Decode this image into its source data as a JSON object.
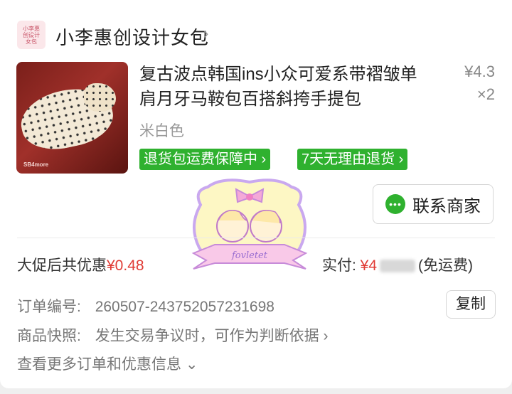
{
  "store": {
    "logo_lines": [
      "小李惠",
      "创设计",
      "女包"
    ],
    "name": "小李惠创设计女包",
    "chevron": "›"
  },
  "product": {
    "title": "复古波点韩国ins小众可爱系带褶皱单肩月牙马鞍包百搭斜挎手提包",
    "price": "¥4.3",
    "quantity": "×2",
    "sku": "米白色",
    "image_mark": "SB4more",
    "tags": [
      "退货包运费保障中 ›",
      "7天无理由退货 ›"
    ]
  },
  "contact_button": {
    "label": "联系商家",
    "icon": "chat-bubble-icon"
  },
  "summary": {
    "discount_prefix": "大促后共优惠",
    "discount_amount": "¥0.48",
    "paid_prefix": "实付: ",
    "paid_amount": "¥4",
    "paid_suffix": "(免运费)"
  },
  "order": {
    "label": "订单编号:",
    "number": "260507-243752057231698",
    "copy_label": "复制"
  },
  "snapshot": {
    "label": "商品快照:",
    "text": "发生交易争议时，可作为判断依据 ›"
  },
  "more": {
    "text": "查看更多订单和优惠信息 ⌄"
  },
  "sticker": {
    "text": "fovletet"
  },
  "colors": {
    "accent_green": "#2fb12f",
    "price_red": "#e03b35"
  }
}
